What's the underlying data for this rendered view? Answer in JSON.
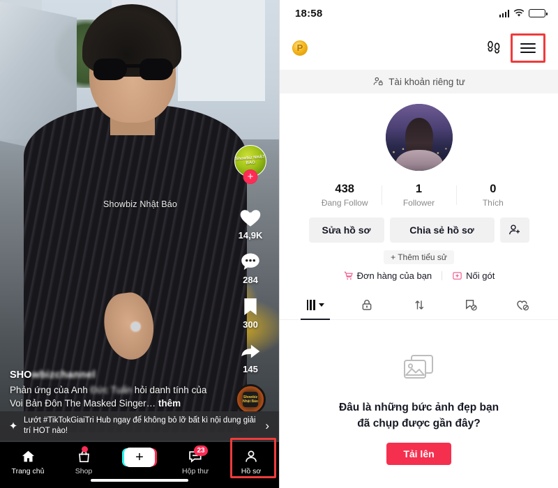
{
  "video": {
    "watermark": "Showbiz Nhật Báo",
    "creator_avatar_label": "Showbiz NHẬT BÁO",
    "follow_button": "+",
    "like_count": "14,9K",
    "comment_count": "284",
    "bookmark_count": "300",
    "share_count": "145",
    "music_disc_label": "Showbiz Nhật Báo",
    "caption": {
      "username_visible": "SHO",
      "username_blurred": "wbizchannel",
      "text_line1": "Phản ứng của Anh",
      "text_blurred": "Đức Tuấn",
      "text_line2": "hỏi danh tính",
      "text_line3": "của Voi Bản Đôn The Masked Singer…",
      "more_label": "thêm"
    },
    "hub_banner": {
      "icon": "sparkle-icon",
      "text": "Lướt #TikTokGiaiTri Hub ngay để không bỏ lỡ bất kì nội dung giải trí HOT nào!",
      "chevron": "›"
    },
    "tabbar": [
      {
        "id": "home",
        "icon": "home-icon",
        "label": "Trang chủ",
        "badge": ""
      },
      {
        "id": "shop",
        "icon": "shop-bag-icon",
        "label": "Shop",
        "badge": "dot"
      },
      {
        "id": "create",
        "icon": "plus-icon",
        "label": "",
        "badge": ""
      },
      {
        "id": "inbox",
        "icon": "inbox-icon",
        "label": "Hộp thư",
        "badge": "23"
      },
      {
        "id": "profile",
        "icon": "person-icon",
        "label": "Hồ sơ",
        "badge": ""
      }
    ]
  },
  "profile": {
    "statusbar": {
      "time": "18:58",
      "signal_icon": "signal-bars-icon",
      "wifi_icon": "wifi-icon",
      "battery_icon": "battery-icon"
    },
    "header": {
      "coin_icon": "p-coin-icon",
      "coin_label": "P",
      "friends_icon": "footprints-icon",
      "menu_icon": "hamburger-menu-icon"
    },
    "private_bar": {
      "icon": "private-person-icon",
      "label": "Tài khoản riêng tư"
    },
    "avatar": "profile-avatar",
    "stats": [
      {
        "number": "438",
        "label": "Đang Follow"
      },
      {
        "number": "1",
        "label": "Follower"
      },
      {
        "number": "0",
        "label": "Thích"
      }
    ],
    "actions": {
      "edit_label": "Sửa hồ sơ",
      "share_label": "Chia sẻ hồ sơ",
      "add_friend_icon": "add-person-icon"
    },
    "add_bio_label": "+ Thêm tiểu sử",
    "links": [
      {
        "icon": "cart-icon",
        "label": "Đơn hàng của bạn"
      },
      {
        "icon": "add-box-icon",
        "label": "Nối gót"
      }
    ],
    "tabs": [
      {
        "id": "videos",
        "icon": "grid-icon",
        "active": true
      },
      {
        "id": "private",
        "icon": "lock-icon",
        "active": false
      },
      {
        "id": "reposts",
        "icon": "repost-arrows-icon",
        "active": false
      },
      {
        "id": "saved",
        "icon": "bookmark-slash-icon",
        "active": false
      },
      {
        "id": "liked",
        "icon": "heart-slash-icon",
        "active": false
      }
    ],
    "empty_state": {
      "icon": "photos-icon",
      "title_line1": "Đâu là những bức ảnh đẹp bạn",
      "title_line2": "đã chụp được gần đây?",
      "button_label": "Tải lên"
    }
  },
  "highlights": {
    "menu_box_color": "#ef3b3b",
    "profile_tab_box_color": "#ef3b3b"
  },
  "colors": {
    "accent_red": "#fe2c55",
    "upload_red": "#f5304f",
    "secondary_bg": "#f1f1f2"
  }
}
